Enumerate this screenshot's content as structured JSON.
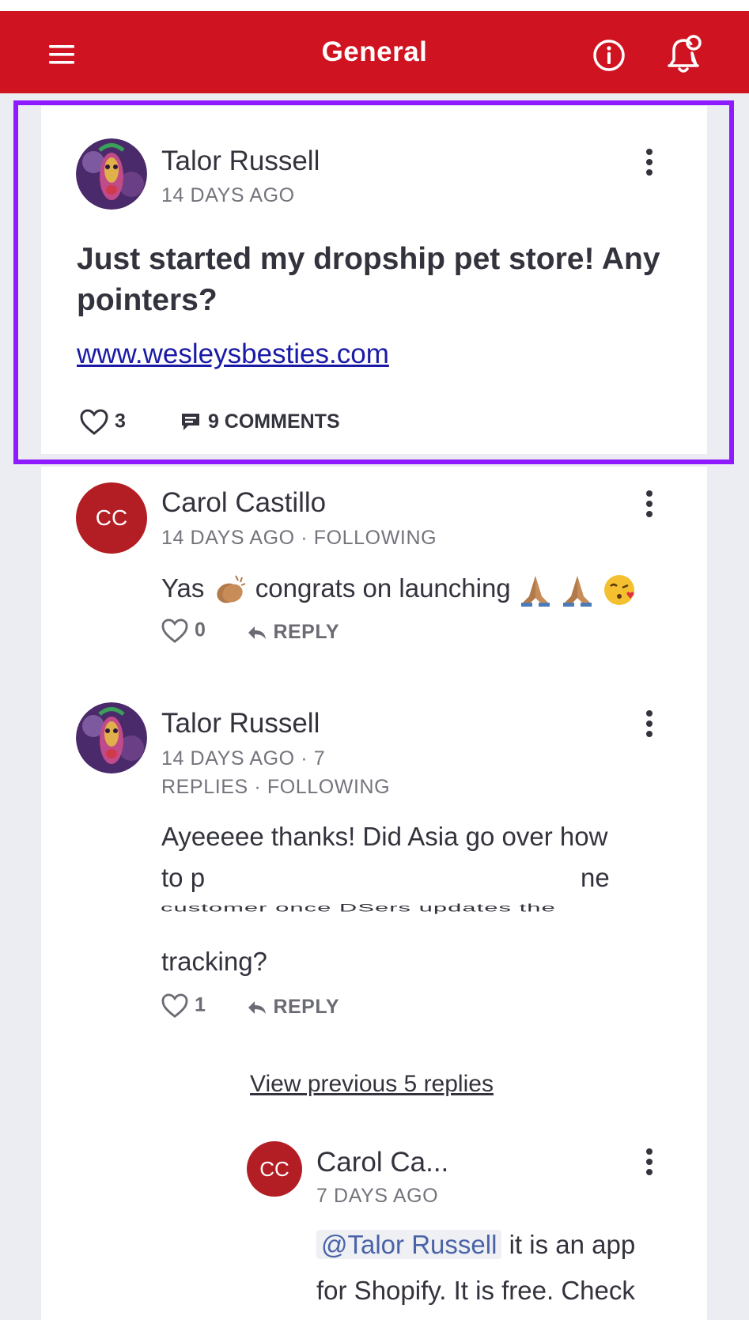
{
  "header": {
    "title": "General",
    "menu_icon": "hamburger-menu-icon",
    "info_icon": "info-circle-icon",
    "notification_icon": "bell-notification-icon",
    "bar_color": "#d01320"
  },
  "post": {
    "author": "Talor Russell",
    "timestamp": "14 DAYS AGO",
    "text": "Just started my dropship pet store! Any pointers?",
    "link": "www.wesleysbesties.com",
    "likes": "3",
    "comments_label": "9 COMMENTS",
    "highlight_color": "#8e1aff"
  },
  "comments": [
    {
      "author": "Carol Castillo",
      "initials": "CC",
      "meta": "14 DAYS AGO · FOLLOWING",
      "text_parts": [
        "Yas",
        "congrats on launching"
      ],
      "likes": "0",
      "reply_label": "REPLY"
    },
    {
      "author": "Talor Russell",
      "meta_line1": "14 DAYS AGO · 7",
      "meta_line2": "REPLIES · FOLLOWING",
      "text_line1": "Ayeeeee thanks! Did Asia go over how",
      "text_line2_start": "to p",
      "text_line2_end": "ne",
      "text_line3": "customer once DSers updates the",
      "text_line4": "tracking?",
      "likes": "1",
      "reply_label": "REPLY"
    }
  ],
  "view_previous": "View previous 5 replies",
  "nested_reply": {
    "author": "Carol Ca...",
    "initials": "CC",
    "timestamp": "7 DAYS AGO",
    "mention": "@Talor Russell",
    "text_after_mention": "it is an app",
    "text_line2": "for Shopify. It is free. Check"
  }
}
